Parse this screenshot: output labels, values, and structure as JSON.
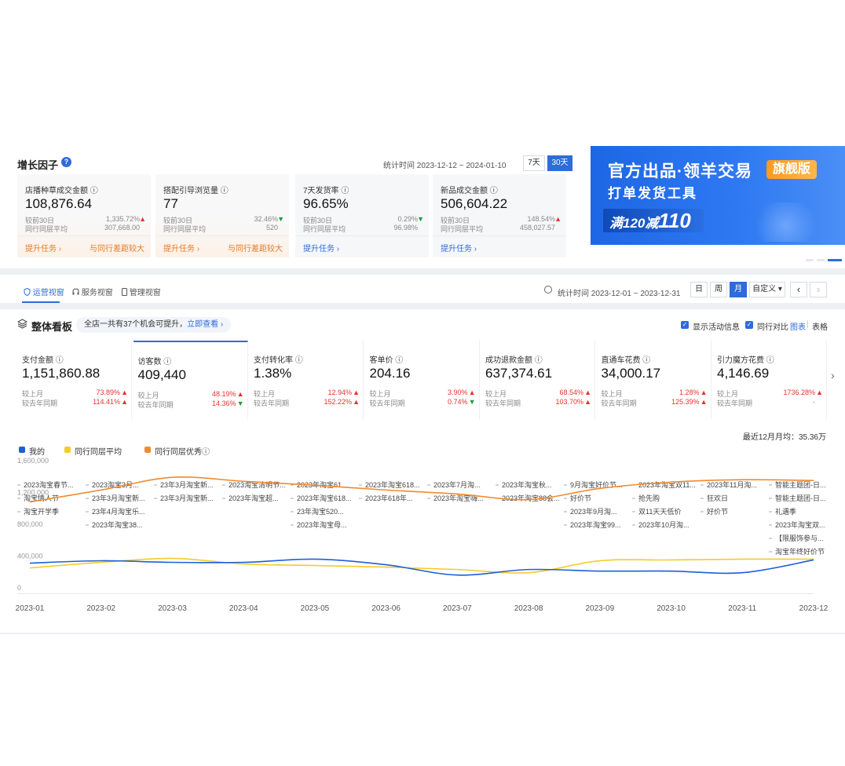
{
  "growth": {
    "title": "增长因子",
    "help": "?",
    "stat_time": "统计时间 2023-12-12 ~ 2024-01-10",
    "range_7": "7天",
    "range_30": "30天",
    "cards": [
      {
        "label": "店播种草成交金额 ⓘ",
        "value": "108,876.64",
        "r1_label": "较前30日",
        "r1_value": "1,335.72%",
        "r1_dir": "up",
        "r2_label": "同行同层平均",
        "r2_value": "307,668.00",
        "task": "提升任务 ›",
        "gap": "与同行差距较大",
        "highlight": true
      },
      {
        "label": "搭配引导浏览量 ⓘ",
        "value": "77",
        "r1_label": "较前30日",
        "r1_value": "32.46%",
        "r1_dir": "down",
        "r2_label": "同行同层平均",
        "r2_value": "520",
        "task": "提升任务 ›",
        "gap": "与同行差距较大",
        "highlight": true
      },
      {
        "label": "7天发货率 ⓘ",
        "value": "96.65%",
        "r1_label": "较前30日",
        "r1_value": "0.29%",
        "r1_dir": "down",
        "r2_label": "同行同层平均",
        "r2_value": "96.98%",
        "task": "提升任务 ›",
        "gap": "",
        "highlight": false
      },
      {
        "label": "新品成交金额 ⓘ",
        "value": "506,604.22",
        "r1_label": "较前30日",
        "r1_value": "148.54%",
        "r1_dir": "up",
        "r2_label": "同行同层平均",
        "r2_value": "458,027.57",
        "task": "提升任务 ›",
        "gap": "",
        "highlight": false
      }
    ]
  },
  "banner": {
    "title": "官方出品·领羊交易",
    "badge": "旗舰版",
    "subtitle": "打单发货工具",
    "promo_prefix": "满120减",
    "promo_big": "110"
  },
  "tabs": [
    {
      "label": "运营视窗",
      "icon": "shield-icon"
    },
    {
      "label": "服务视窗",
      "icon": "headset-icon"
    },
    {
      "label": "管理视窗",
      "icon": "phone-icon"
    }
  ],
  "board": {
    "stat_time": "统计时间 2023-12-01 ~ 2023-12-31",
    "periods": [
      "日",
      "周",
      "月",
      "自定义 ▾"
    ],
    "prev": "‹",
    "next": "›",
    "title": "整体看板",
    "chance_text": "全店一共有37个机会可提升，",
    "chance_link": "立即查看 ›",
    "show_activity": "显示活动信息",
    "peer_compare": "同行对比",
    "view_chart": "图表",
    "view_sep": "|",
    "view_table": "表格",
    "check": "✓",
    "metrics_next": "›"
  },
  "metrics": [
    {
      "label": "支付金额 ⓘ",
      "value": "1,151,860.88",
      "r1_label": "较上月",
      "r1_value": "73.89%",
      "r1_dir": "up",
      "r2_label": "较去年同期",
      "r2_value": "114.41%",
      "r2_dir": "up"
    },
    {
      "label": "访客数 ⓘ",
      "value": "409,440",
      "r1_label": "较上月",
      "r1_value": "48.19%",
      "r1_dir": "up",
      "r2_label": "较去年同期",
      "r2_value": "14.36%",
      "r2_dir": "down"
    },
    {
      "label": "支付转化率 ⓘ",
      "value": "1.38%",
      "r1_label": "较上月",
      "r1_value": "12.94%",
      "r1_dir": "up",
      "r2_label": "较去年同期",
      "r2_value": "152.22%",
      "r2_dir": "up"
    },
    {
      "label": "客单价 ⓘ",
      "value": "204.16",
      "r1_label": "较上月",
      "r1_value": "3.90%",
      "r1_dir": "up",
      "r2_label": "较去年同期",
      "r2_value": "0.74%",
      "r2_dir": "down"
    },
    {
      "label": "成功退款金额 ⓘ",
      "value": "637,374.61",
      "r1_label": "较上月",
      "r1_value": "68.54%",
      "r1_dir": "up",
      "r2_label": "较去年同期",
      "r2_value": "103.70%",
      "r2_dir": "up"
    },
    {
      "label": "直通车花费 ⓘ",
      "value": "34,000.17",
      "r1_label": "较上月",
      "r1_value": "1.28%",
      "r1_dir": "up",
      "r2_label": "较去年同期",
      "r2_value": "125.39%",
      "r2_dir": "up"
    },
    {
      "label": "引力魔方花费 ⓘ",
      "value": "4,146.69",
      "r1_label": "较上月",
      "r1_value": "1736.28%",
      "r1_dir": "up",
      "r2_label": "较去年同期",
      "r2_value": "-",
      "r2_dir": "none"
    }
  ],
  "summary": "最近12月月均：35.36万",
  "colors": {
    "primary": "#2f6bd9",
    "mine": "#1f5fd6",
    "peer_avg": "#f3cc2d",
    "peer_top": "#f28a2e",
    "up": "#e5342b",
    "down": "#1c9b3b"
  },
  "chart_data": {
    "type": "line",
    "x": [
      "2023-01",
      "2023-02",
      "2023-03",
      "2023-04",
      "2023-05",
      "2023-06",
      "2023-07",
      "2023-08",
      "2023-09",
      "2023-10",
      "2023-11",
      "2023-12"
    ],
    "ylim": [
      0,
      1600000
    ],
    "y_ticks": [
      {
        "value": 0,
        "label": "0"
      },
      {
        "value": 400000,
        "label": "400,000"
      },
      {
        "value": 800000,
        "label": "800,000"
      },
      {
        "value": 1200000,
        "label": "1,200,000"
      },
      {
        "value": 1600000,
        "label": "1,600,000"
      }
    ],
    "legend": "top-left",
    "series": [
      {
        "name": "我的",
        "color": "#1f5fd6",
        "values": [
          380000,
          410000,
          390000,
          390000,
          430000,
          360000,
          230000,
          300000,
          280000,
          280000,
          260000,
          420000
        ]
      },
      {
        "name": "同行同层平均",
        "color": "#f3cc2d",
        "values": [
          320000,
          390000,
          440000,
          370000,
          350000,
          330000,
          300000,
          260000,
          410000,
          420000,
          430000,
          430000
        ]
      },
      {
        "name": "同行同层优秀ⓘ",
        "color": "#f28a2e",
        "values": [
          1150000,
          1300000,
          1460000,
          1410000,
          1360000,
          1300000,
          1250000,
          1180000,
          1320000,
          1400000,
          1430000,
          1420000
        ]
      }
    ],
    "activities": [
      [
        "2023淘宝春节...",
        "淘宝情人节",
        "淘宝开学季"
      ],
      [
        "2023淘宝3月...",
        "23年3月淘宝新...",
        "23年4月淘宝乐...",
        "2023年淘宝38..."
      ],
      [
        "23年3月淘宝新...",
        "23年3月淘宝新..."
      ],
      [
        "2023淘宝清明节...",
        "2023年淘宝超..."
      ],
      [
        "2023年淘宝61...",
        "2023年淘宝618...",
        "23年淘宝520...",
        "2023年淘宝母..."
      ],
      [
        "2023年淘宝618...",
        "2023年618年..."
      ],
      [
        "2023年7月淘...",
        "2023年淘宝嗨..."
      ],
      [
        "2023年淘宝秋...",
        "2023年淘宝88会..."
      ],
      [
        "9月淘宝好价节...",
        "好价节",
        "2023年9月淘...",
        "2023年淘宝99..."
      ],
      [
        "2023年淘宝双11...",
        "抢先购",
        "双11天天低价",
        "2023年10月淘..."
      ],
      [
        "2023年11月淘...",
        "狂欢日",
        "好价节"
      ],
      [
        "智能主题团-日...",
        "智能主题团-日...",
        "礼遇季",
        "2023年淘宝双...",
        "【限服饰参与...",
        "淘宝年终好价节"
      ]
    ]
  }
}
